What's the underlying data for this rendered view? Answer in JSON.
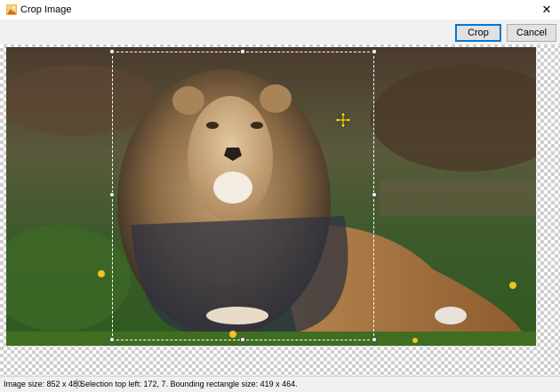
{
  "window": {
    "title": "Crop Image",
    "close_glyph": "✕",
    "app_icon": "image-app-icon"
  },
  "toolbar": {
    "crop_label": "Crop",
    "cancel_label": "Cancel"
  },
  "image": {
    "description_icon": "photo-lion"
  },
  "statusbar": {
    "image_size": "Image size: 852 x 480.",
    "selection_info": "Selection top left: 172, 7. Bounding rectangle size: 419 x 464."
  },
  "colors": {
    "accent": "#0078d7",
    "button_bg": "#e1e1e1",
    "checker": "#cfcfcf"
  }
}
